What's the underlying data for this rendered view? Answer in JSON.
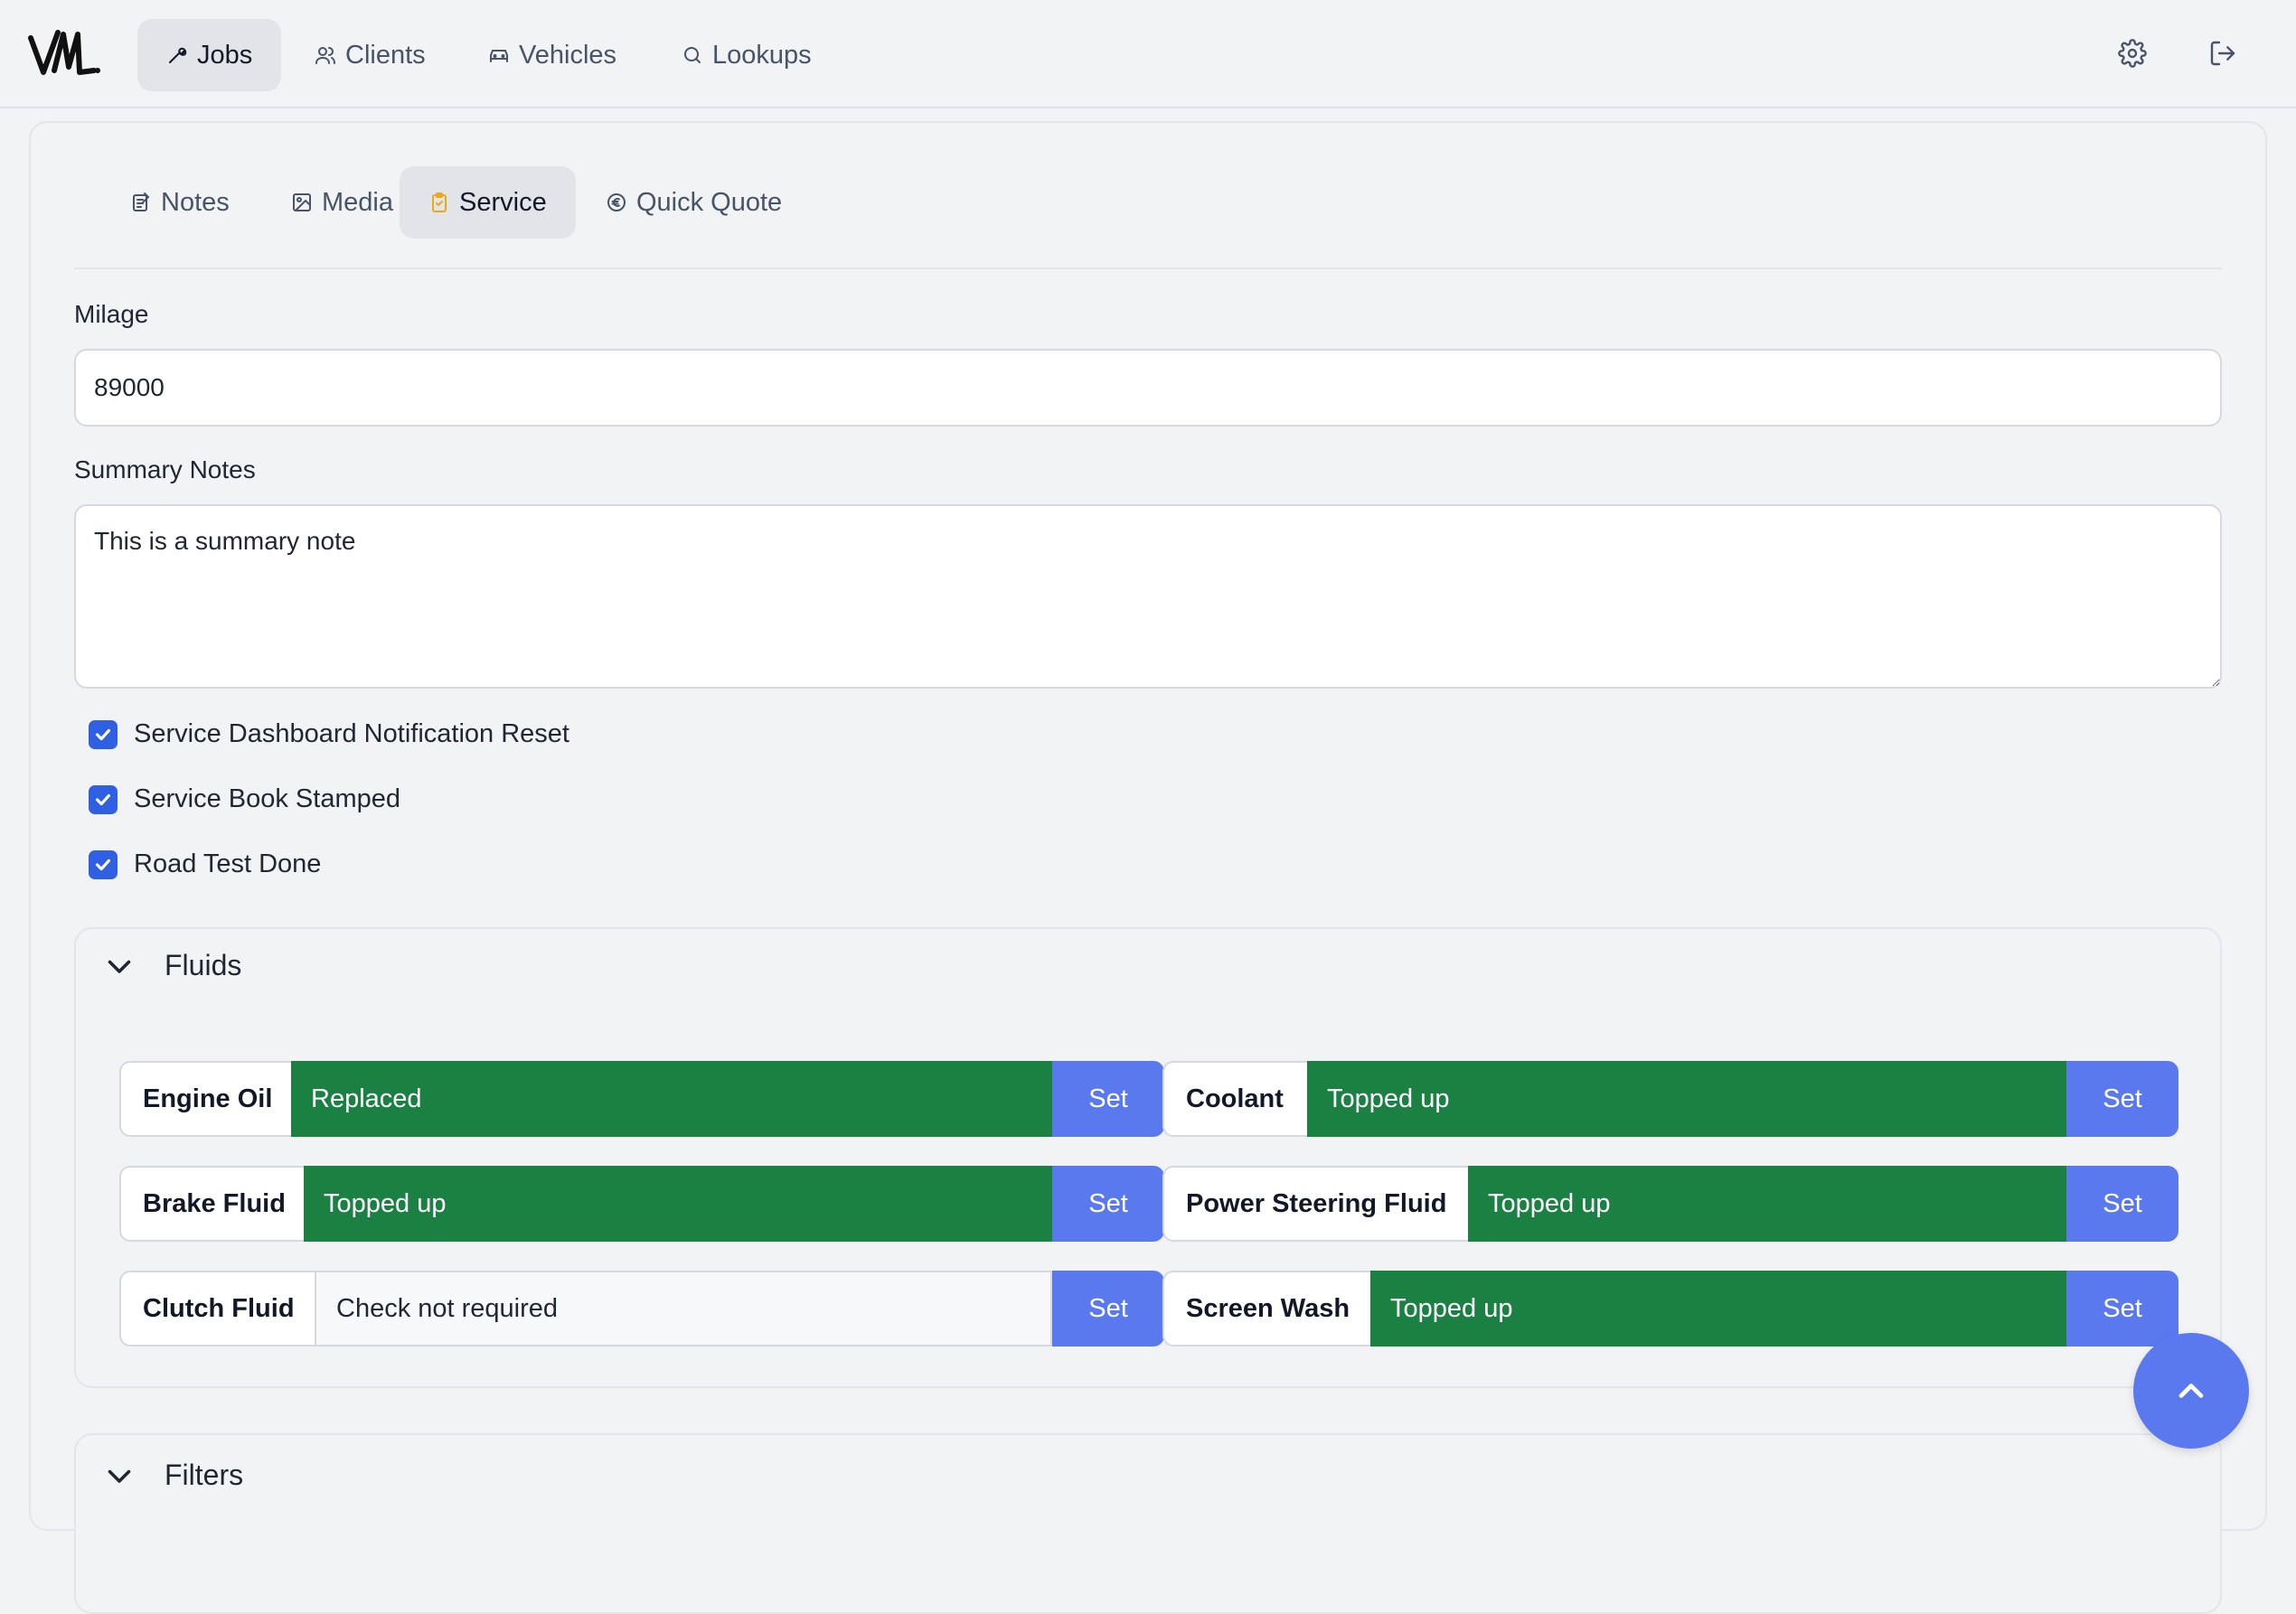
{
  "nav": {
    "items": [
      {
        "label": "Jobs",
        "icon": "wrench-icon",
        "active": true
      },
      {
        "label": "Clients",
        "icon": "users-icon",
        "active": false
      },
      {
        "label": "Vehicles",
        "icon": "car-icon",
        "active": false
      },
      {
        "label": "Lookups",
        "icon": "search-icon",
        "active": false
      }
    ],
    "settings_icon": "gear-icon",
    "logout_icon": "logout-icon"
  },
  "tabs": [
    {
      "label": "Notes",
      "icon": "notes-icon",
      "active": false
    },
    {
      "label": "Media",
      "icon": "image-icon",
      "active": false
    },
    {
      "label": "Service",
      "icon": "clipboard-icon",
      "active": true
    },
    {
      "label": "Quick Quote",
      "icon": "euro-icon",
      "active": false
    }
  ],
  "form": {
    "milage_label": "Milage",
    "milage_value": "89000",
    "summary_label": "Summary Notes",
    "summary_value": "This is a summary note",
    "checks": [
      {
        "label": "Service Dashboard Notification Reset",
        "checked": true
      },
      {
        "label": "Service Book Stamped",
        "checked": true
      },
      {
        "label": "Road Test Done",
        "checked": true
      }
    ]
  },
  "fluids": {
    "title": "Fluids",
    "set_label": "Set",
    "items": [
      {
        "name": "Engine Oil",
        "status": "Replaced",
        "state": "done"
      },
      {
        "name": "Coolant",
        "status": "Topped up",
        "state": "done"
      },
      {
        "name": "Brake Fluid",
        "status": "Topped up",
        "state": "done"
      },
      {
        "name": "Power Steering Fluid",
        "status": "Topped up",
        "state": "done"
      },
      {
        "name": "Clutch Fluid",
        "status": "Check not required",
        "state": "none"
      },
      {
        "name": "Screen Wash",
        "status": "Topped up",
        "state": "done"
      }
    ]
  },
  "filters": {
    "title": "Filters"
  },
  "colors": {
    "accent": "#5b79ef",
    "done": "#1b8142",
    "checkbox": "#2f5fe3",
    "tab_active_icon": "#e9a91c"
  }
}
